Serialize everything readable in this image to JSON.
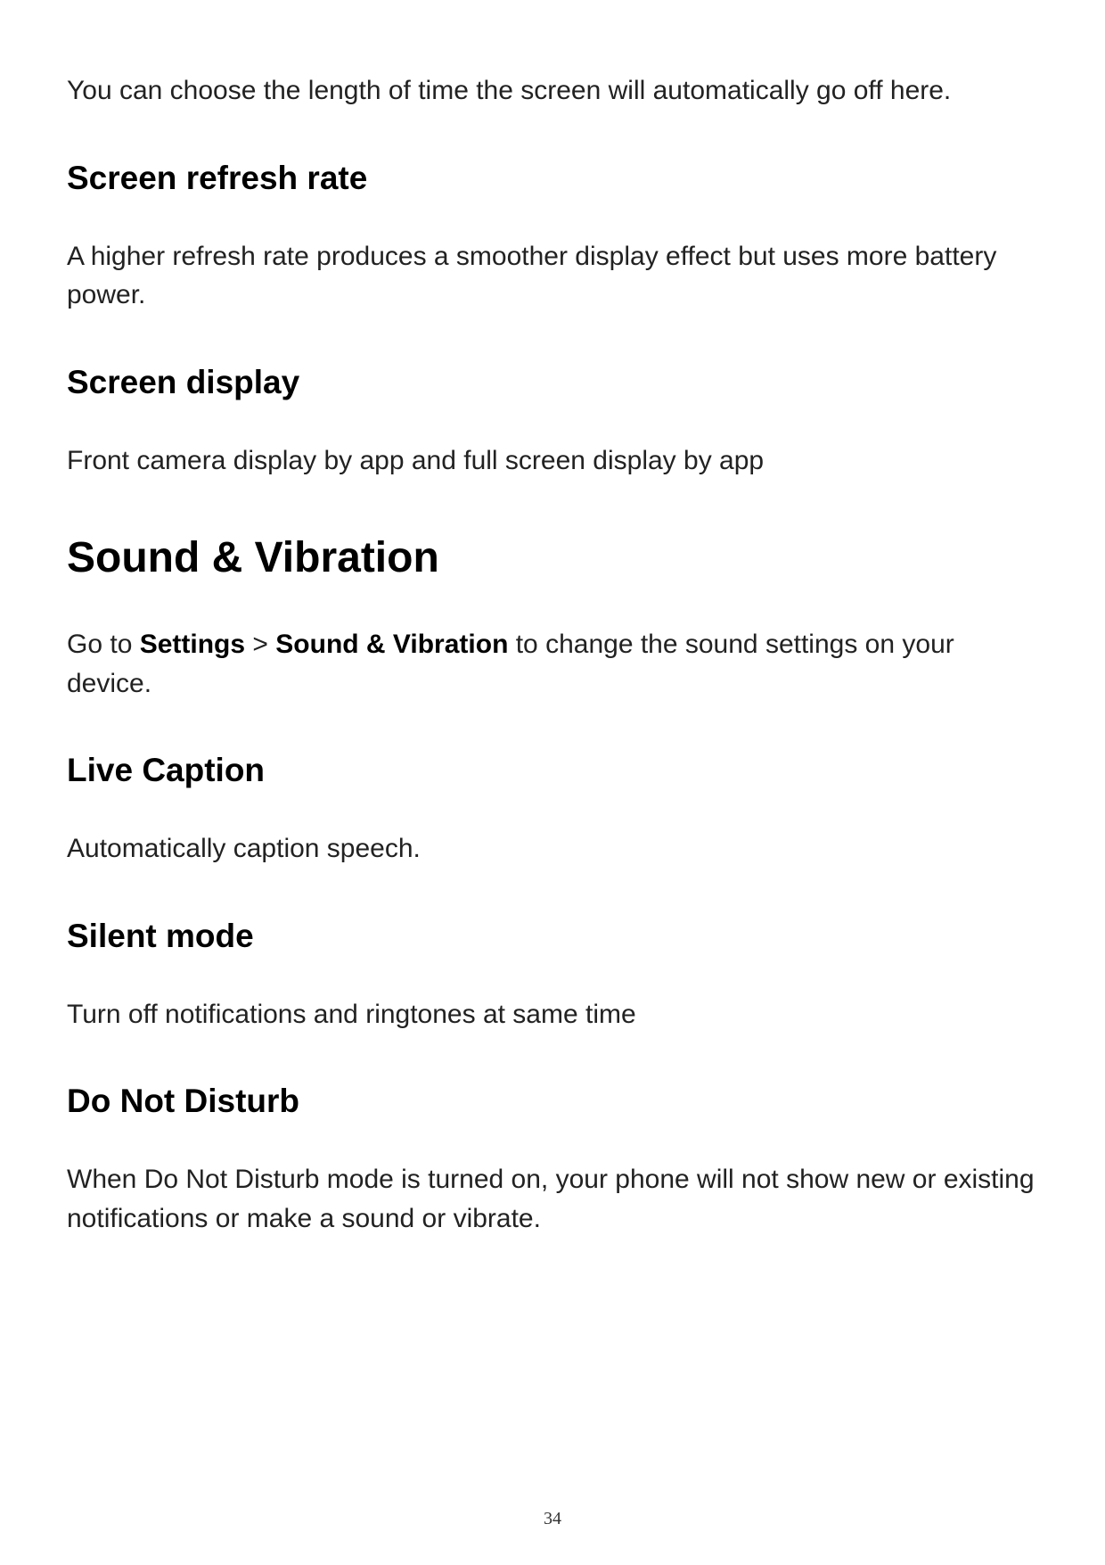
{
  "intro": "You can choose the length of time the screen will automatically go off here.",
  "sections": [
    {
      "heading": "Screen refresh rate",
      "body": "A higher refresh rate produces a smoother display effect but uses more battery power."
    },
    {
      "heading": "Screen display",
      "body": "Front camera display by app and full screen display by app"
    }
  ],
  "majorSection": {
    "heading": "Sound & Vibration",
    "intro_prefix": "Go to ",
    "intro_bold1": "Settings",
    "intro_sep": " > ",
    "intro_bold2": "Sound & Vibration",
    "intro_suffix": " to change the sound settings on your device.",
    "subsections": [
      {
        "heading": "Live Caption",
        "body": "Automatically caption speech."
      },
      {
        "heading": "Silent mode",
        "body": "Turn off notifications and ringtones at same time"
      },
      {
        "heading": "Do Not Disturb",
        "body": "When Do Not Disturb mode is turned on, your phone will not show new or existing notifications or make a sound or vibrate."
      }
    ]
  },
  "pageNumber": "34"
}
